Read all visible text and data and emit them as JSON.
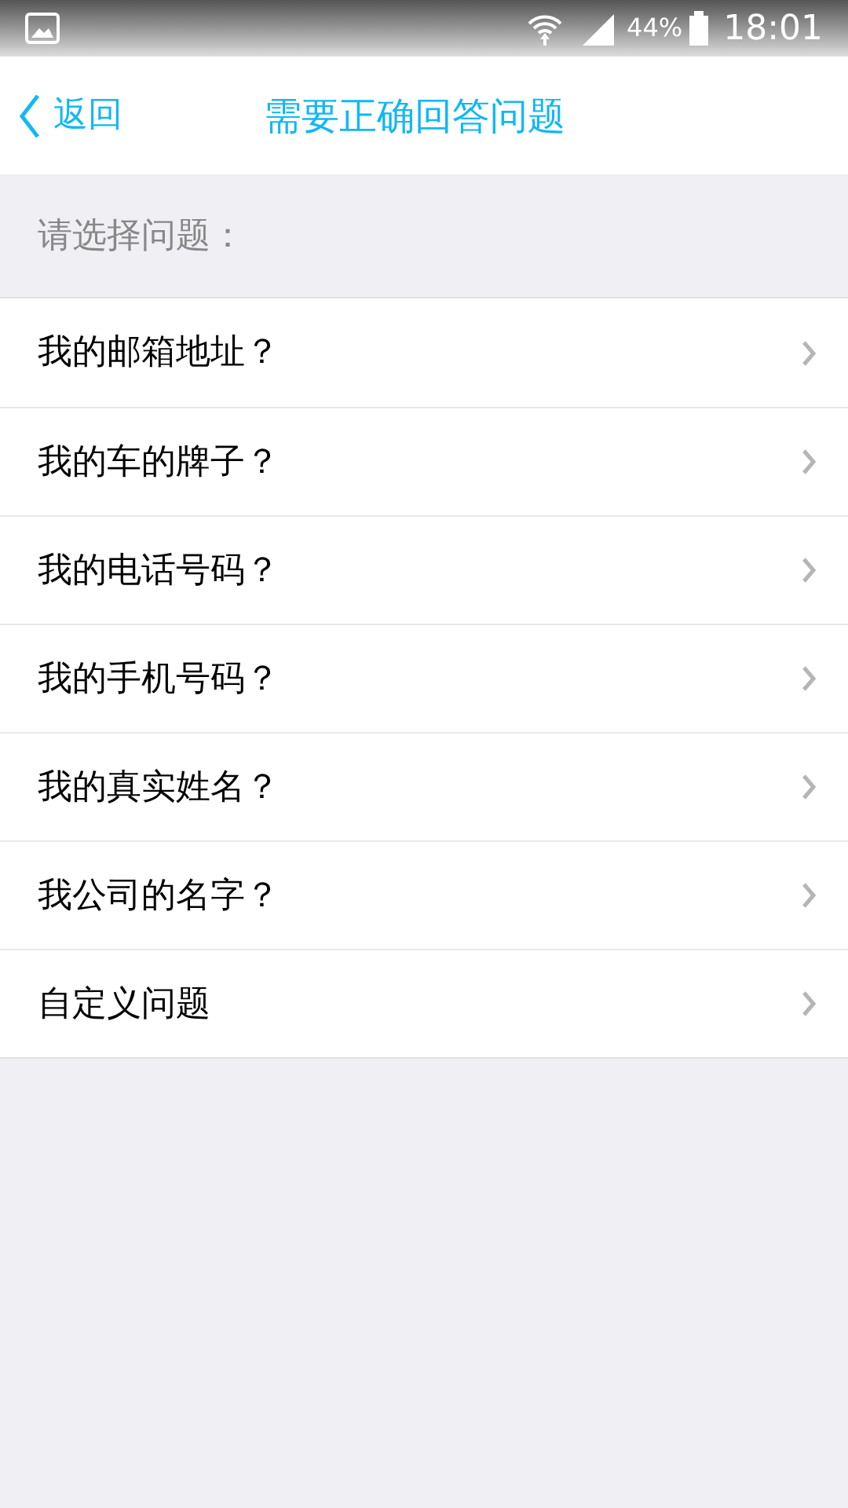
{
  "status_bar": {
    "battery": "44%",
    "time": "18:01"
  },
  "header": {
    "back": "返回",
    "title": "需要正确回答问题"
  },
  "section_label": "请选择问题：",
  "questions": [
    {
      "label": "我的邮箱地址？"
    },
    {
      "label": "我的车的牌子？"
    },
    {
      "label": "我的电话号码？"
    },
    {
      "label": "我的手机号码？"
    },
    {
      "label": "我的真实姓名？"
    },
    {
      "label": "我公司的名字？"
    },
    {
      "label": "自定义问题"
    }
  ]
}
